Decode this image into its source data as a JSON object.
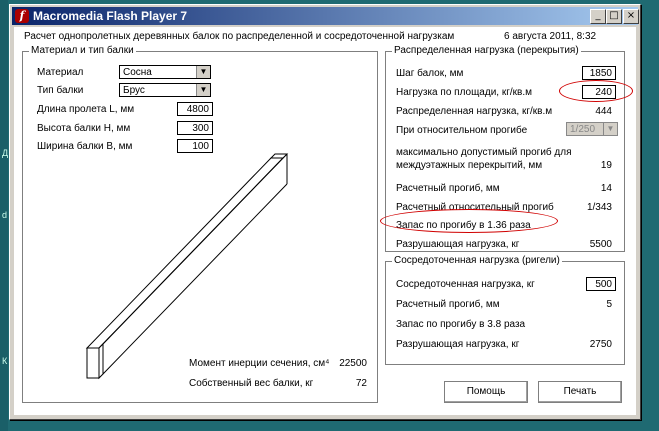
{
  "desktop": {
    "labels": [
      "Д",
      "d",
      "К"
    ]
  },
  "window": {
    "title": "Macromedia Flash Player 7",
    "controls": {
      "minimize": "_",
      "maximize": "□",
      "close": "×"
    }
  },
  "header": {
    "title": "Расчет однопролетных деревянных балок по распределенной и сосредоточенной нагрузкам",
    "date": "6 августа 2011, 8:32"
  },
  "material": {
    "legend": "Материал и тип балки",
    "material_label": "Материал",
    "material_value": "Сосна",
    "beam_type_label": "Тип балки",
    "beam_type_value": "Брус",
    "span_label": "Длина пролета L, мм",
    "span_value": "4800",
    "height_label": "Высота балки H, мм",
    "height_value": "300",
    "width_label": "Ширина балки В, мм",
    "width_value": "100",
    "inertia_label": "Момент инерции сечения, см⁴",
    "inertia_value": "22500",
    "weight_label": "Собственный вес балки, кг",
    "weight_value": "72"
  },
  "distributed": {
    "legend": "Распределенная нагрузка (перекрытия)",
    "step_label": "Шаг балок, мм",
    "step_value": "1850",
    "area_load_label": "Нагрузка по площади, кг/кв.м",
    "area_load_value": "240",
    "dist_load_label": "Распределенная нагрузка, кг/кв.м",
    "dist_load_value": "444",
    "rel_deflection_label": "При относительном прогибе",
    "rel_deflection_value": "1/250",
    "max_deflection_label_1": "максимально допустимый прогиб для",
    "max_deflection_label_2": "междуэтажных перекрытий, мм",
    "max_deflection_value": "19",
    "calc_deflection_label": "Расчетный прогиб, мм",
    "calc_deflection_value": "14",
    "calc_rel_label": "Расчетный относительный прогиб",
    "calc_rel_value": "1/343",
    "margin_text": "Запас по прогибу в 1.36 раза",
    "breaking_label": "Разрушающая нагрузка, кг",
    "breaking_value": "5500"
  },
  "concentrated": {
    "legend": "Сосредоточенная нагрузка (ригели)",
    "load_label": "Сосредоточенная нагрузка, кг",
    "load_value": "500",
    "deflection_label": "Расчетный прогиб, мм",
    "deflection_value": "5",
    "margin_text": "Запас по прогибу в 3.8 раза",
    "breaking_label": "Разрушающая нагрузка, кг",
    "breaking_value": "2750"
  },
  "buttons": {
    "help": "Помощь",
    "print": "Печать"
  },
  "colors": {
    "annotation": "#d00000",
    "titlebar_start": "#0a246a",
    "titlebar_end": "#a6caf0"
  }
}
